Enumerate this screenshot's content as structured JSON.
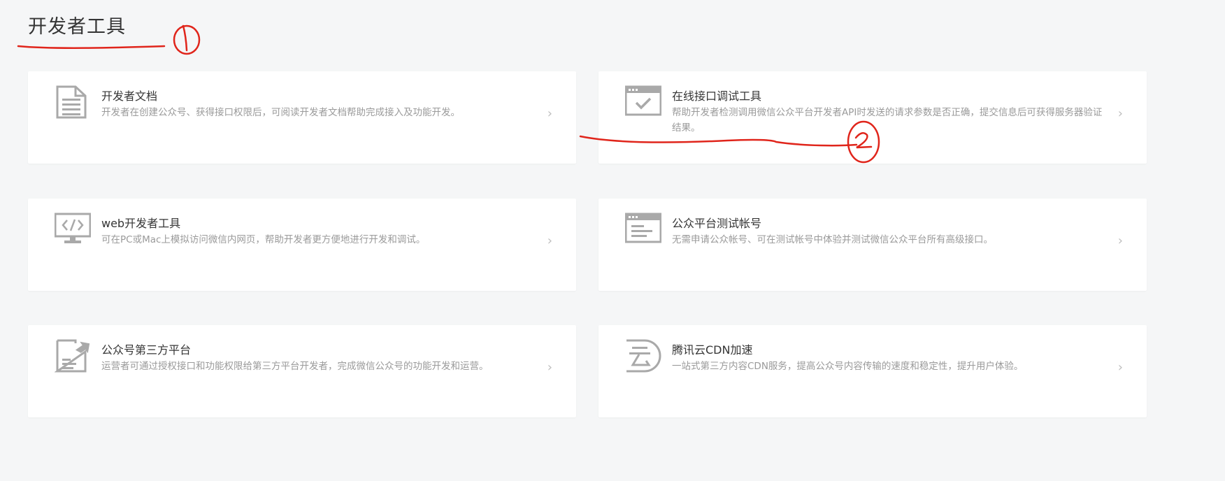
{
  "page": {
    "title": "开发者工具"
  },
  "cards": [
    {
      "icon": "document-icon",
      "title": "开发者文档",
      "desc": "开发者在创建公众号、获得接口权限后，可阅读开发者文档帮助完成接入及功能开发。"
    },
    {
      "icon": "window-check-icon",
      "title": "在线接口调试工具",
      "desc": "帮助开发者检测调用微信公众平台开发者API时发送的请求参数是否正确，提交信息后可获得服务器验证结果。"
    },
    {
      "icon": "monitor-code-icon",
      "title": "web开发者工具",
      "desc": "可在PC或Mac上模拟访问微信内网页，帮助开发者更方便地进行开发和调试。"
    },
    {
      "icon": "browser-window-icon",
      "title": "公众平台测试帐号",
      "desc": "无需申请公众帐号、可在测试帐号中体验并测试微信公众平台所有高级接口。"
    },
    {
      "icon": "document-arrow-icon",
      "title": "公众号第三方平台",
      "desc": "运营者可通过授权接口和功能权限给第三方平台开发者，完成微信公众号的功能开发和运营。"
    },
    {
      "icon": "cloud-cdn-icon",
      "title": "腾讯云CDN加速",
      "desc": "一站式第三方内容CDN服务，提高公众号内容传输的速度和稳定性，提升用户体验。"
    }
  ],
  "colors": {
    "background": "#f5f6f7",
    "card": "#ffffff",
    "icon": "#a9a9a9",
    "annotation": "#e0251b"
  }
}
